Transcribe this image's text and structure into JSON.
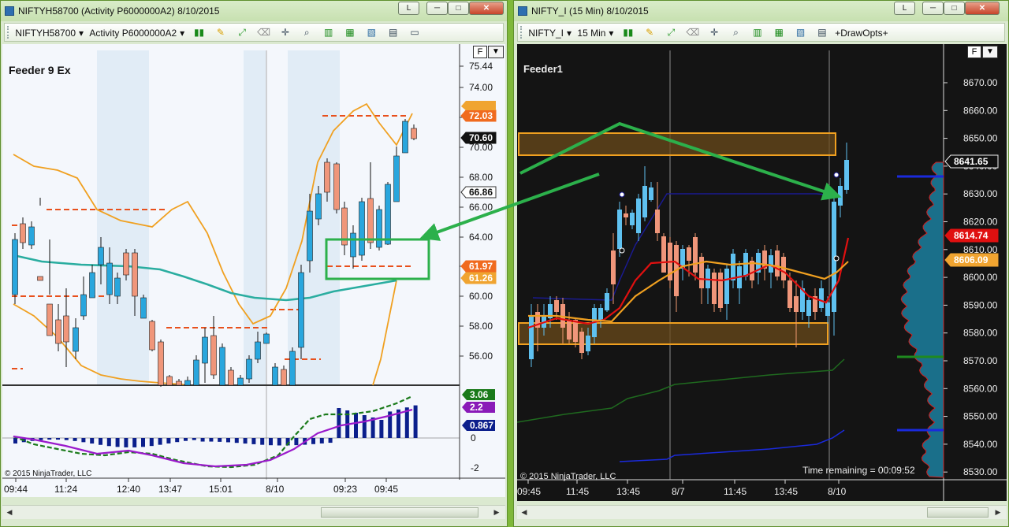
{
  "left_window": {
    "title": "NIFTYH58700 (Activity P6000000A2)  8/10/2015",
    "toolbar": {
      "instrument": "NIFTYH58700",
      "template": "Activity P6000000A2"
    },
    "buttons": {
      "link": "L",
      "minimize": "─",
      "maximize": "□",
      "close": "✕"
    },
    "chart_label": "Feeder 9 Ex",
    "copyright": "© 2015 NinjaTrader, LLC",
    "price_axis_ticks": [
      "75.44",
      "74.00",
      "72.00",
      "70.00",
      "68.00",
      "66.00",
      "64.00",
      "62.00",
      "60.00",
      "58.00",
      "56.00"
    ],
    "price_markers": [
      {
        "label": "72.03",
        "color": "#f06a1e"
      },
      {
        "label": "70.60",
        "color": "#111111"
      },
      {
        "label": "66.86",
        "color": "#ffffff"
      },
      {
        "label": "61.97",
        "color": "#f06a1e"
      },
      {
        "label": "61.26",
        "color": "#f0a430"
      }
    ],
    "osc_ticks": [
      "0",
      "-2"
    ],
    "osc_markers": [
      {
        "label": "3.06",
        "color": "#1a7a1a"
      },
      {
        "label": "2.2",
        "color": "#8a1ab8"
      },
      {
        "label": "0.867",
        "color": "#0c1f8c"
      }
    ],
    "time_ticks": [
      "09:44",
      "11:24",
      "12:40",
      "13:47",
      "15:01",
      "8/10",
      "09:23",
      "09:45"
    ]
  },
  "right_window": {
    "title": "NIFTY_I (15 Min)  8/10/2015",
    "toolbar": {
      "instrument": "NIFTY_I",
      "interval": "15 Min",
      "drawopts": "+DrawOpts+"
    },
    "buttons": {
      "link": "L",
      "minimize": "─",
      "maximize": "□",
      "close": "✕"
    },
    "chart_label": "Feeder1",
    "copyright": "© 2015 NinjaTrader, LLC",
    "time_remaining": "Time remaining = 00:09:52",
    "price_axis_ticks": [
      "8670.00",
      "8660.00",
      "8650.00",
      "8640.00",
      "8630.00",
      "8620.00",
      "8610.00",
      "8600.00",
      "8590.00",
      "8580.00",
      "8570.00",
      "8560.00",
      "8550.00",
      "8540.00",
      "8530.00"
    ],
    "price_markers": [
      {
        "label": "8641.65",
        "color": "#111111"
      },
      {
        "label": "8614.74",
        "color": "#e01010"
      },
      {
        "label": "8606.09",
        "color": "#f0a430"
      }
    ],
    "time_ticks": [
      "09:45",
      "11:45",
      "13:45",
      "8/7",
      "11:45",
      "13:45",
      "8/10"
    ]
  },
  "f_button": "F"
}
